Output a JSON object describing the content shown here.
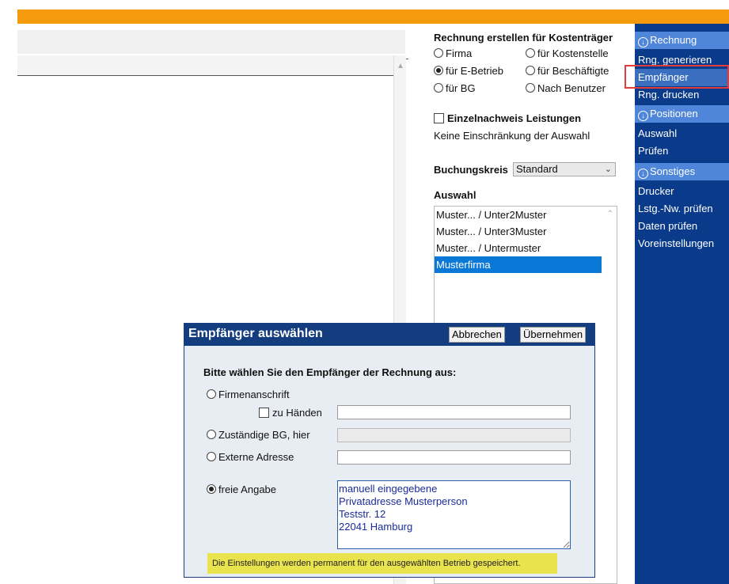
{
  "invoice": {
    "heading": "Rechnung erstellen für Kostenträger",
    "options": [
      {
        "label": "Firma",
        "checked": false
      },
      {
        "label": "für Kostenstelle",
        "checked": false
      },
      {
        "label": "für E-Betrieb",
        "checked": true
      },
      {
        "label": "für Beschäftigte",
        "checked": false
      },
      {
        "label": "für BG",
        "checked": false
      },
      {
        "label": "Nach Benutzer",
        "checked": false
      }
    ],
    "detail_checkbox_label": "Einzelnachweis Leistungen",
    "restriction_text": "Keine Einschränkung der Auswahl",
    "booking_label": "Buchungskreis",
    "booking_value": "Standard",
    "selection_heading": "Auswahl",
    "selection_items": [
      {
        "label": "Muster... / Unter2Muster",
        "selected": false
      },
      {
        "label": "Muster... / Unter3Muster",
        "selected": false
      },
      {
        "label": "Muster... / Untermuster",
        "selected": false
      },
      {
        "label": "Musterfirma",
        "selected": true
      }
    ]
  },
  "sidebar": {
    "sections": [
      {
        "title": "Rechnung",
        "items": [
          {
            "label": "Rng. generieren",
            "active": false
          },
          {
            "label": "Empfänger",
            "active": true
          },
          {
            "label": "Rng. drucken",
            "active": false
          }
        ]
      },
      {
        "title": "Positionen",
        "items": [
          {
            "label": "Auswahl",
            "active": false
          },
          {
            "label": "Prüfen",
            "active": false
          }
        ]
      },
      {
        "title": "Sonstiges",
        "items": [
          {
            "label": "Drucker",
            "active": false
          },
          {
            "label": "Lstg.-Nw. prüfen",
            "active": false
          },
          {
            "label": "Daten prüfen",
            "active": false
          },
          {
            "label": "Voreinstellungen",
            "active": false
          }
        ]
      }
    ]
  },
  "dialog": {
    "title": "Empfänger auswählen",
    "cancel_label": "Abbrechen",
    "accept_label": "Übernehmen",
    "prompt": "Bitte wählen Sie den Empfänger der Rechnung aus:",
    "opt_company": "Firmenanschrift",
    "attention_label": "zu Händen",
    "attention_value": "",
    "opt_bg": "Zuständige BG, hier",
    "bg_value": "",
    "opt_external": "Externe Adresse",
    "external_value": "",
    "opt_free": "freie Angabe",
    "free_text": "manuell eingegebene\nPrivatadresse Musterperson\nTeststr. 12\n22041 Hamburg",
    "note": "Die Einstellungen werden permanent für den ausgewählten Betrieb gespeichert."
  },
  "colors": {
    "accent_orange": "#f59a0c",
    "nav_dark_blue": "#0a3a8a",
    "nav_section_blue": "#4f86d9",
    "selection_blue": "#0a78d7",
    "highlight_red": "#e23b3b",
    "note_yellow": "#e9e34e"
  }
}
